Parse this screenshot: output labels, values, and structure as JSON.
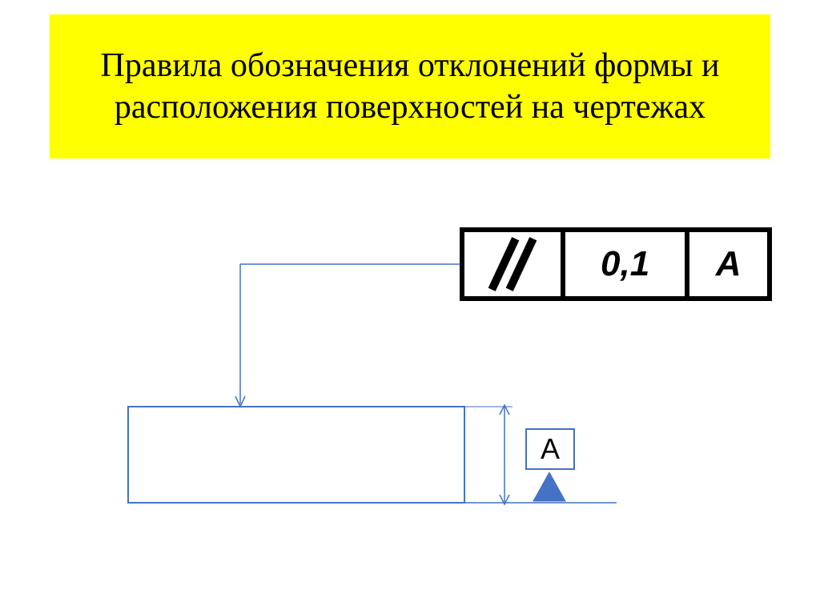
{
  "title": "Правила обозначения отклонений формы и расположения поверхностей на чертежах",
  "tolerance": {
    "symbol_name": "parallelism",
    "value": "0,1",
    "datum_ref": "A"
  },
  "datum": {
    "label": "А"
  },
  "colors": {
    "banner_bg": "#ffff00",
    "line": "#4472c4",
    "frame": "#000000"
  }
}
